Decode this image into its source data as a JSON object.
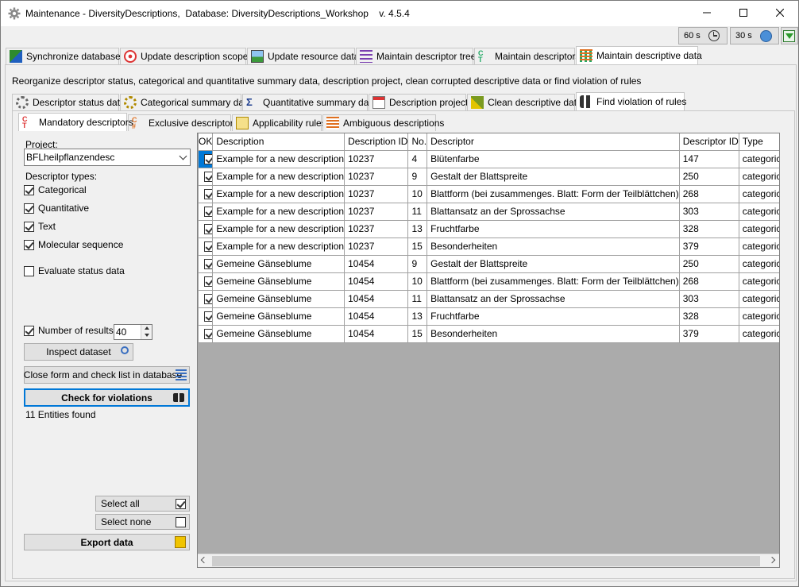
{
  "window": {
    "title": "Maintenance - DiversityDescriptions,  Database: DiversityDescriptions_Workshop    v. 4.5.4",
    "timer1": "60 s",
    "timer2": "30 s"
  },
  "main_tabs": [
    {
      "label": "Synchronize databases"
    },
    {
      "label": "Update description scopes"
    },
    {
      "label": "Update resource data"
    },
    {
      "label": "Maintain descriptor trees"
    },
    {
      "label": "Maintain descriptors"
    },
    {
      "label": "Maintain descriptive data"
    }
  ],
  "info_text": "Reorganize descriptor status, categorical and quantitative summary data, description project, clean corrupted descriptive data or find violation of rules",
  "sub_tabs": [
    {
      "label": "Descriptor status data"
    },
    {
      "label": "Categorical summary data"
    },
    {
      "label": "Quantitative summary data"
    },
    {
      "label": "Description project"
    },
    {
      "label": "Clean descriptive data"
    },
    {
      "label": "Find violation of rules"
    }
  ],
  "rule_tabs": [
    {
      "label": "Mandatory descriptors"
    },
    {
      "label": "Exclusive descriptors"
    },
    {
      "label": "Applicability rules"
    },
    {
      "label": "Ambiguous descriptions"
    }
  ],
  "left": {
    "project_label": "Project:",
    "project_value": "BFLheilpflanzendesc",
    "descriptor_types_label": "Descriptor types:",
    "types": [
      {
        "label": "Categorical",
        "checked": true
      },
      {
        "label": "Quantitative",
        "checked": true
      },
      {
        "label": "Text",
        "checked": true
      },
      {
        "label": "Molecular sequence",
        "checked": true
      }
    ],
    "evaluate_status": "Evaluate status data",
    "num_results_label": "Number of results:",
    "num_results_value": "40",
    "inspect_button": "Inspect dataset",
    "close_button": "Close form and check list in database",
    "check_button": "Check for violations",
    "status": "11 Entities found",
    "select_all": "Select all",
    "select_none": "Select none",
    "export": "Export data"
  },
  "grid": {
    "headers": [
      "OK",
      "Description",
      "Description ID",
      "No.",
      "Descriptor",
      "Descriptor ID",
      "Type"
    ],
    "rows": [
      [
        "Example for a new description",
        "10237",
        "4",
        "Blütenfarbe",
        "147",
        "categorica"
      ],
      [
        "Example for a new description",
        "10237",
        "9",
        "Gestalt der Blattspreite",
        "250",
        "categorica"
      ],
      [
        "Example for a new description",
        "10237",
        "10",
        "Blattform (bei zusammenges. Blatt: Form der Teilblättchen)",
        "268",
        "categorica"
      ],
      [
        "Example for a new description",
        "10237",
        "11",
        "Blattansatz an der Sprossachse",
        "303",
        "categorica"
      ],
      [
        "Example for a new description",
        "10237",
        "13",
        "Fruchtfarbe",
        "328",
        "categorica"
      ],
      [
        "Example for a new description",
        "10237",
        "15",
        "Besonderheiten",
        "379",
        "categorica"
      ],
      [
        "Gemeine Gänseblume",
        "10454",
        "9",
        "Gestalt der Blattspreite",
        "250",
        "categorica"
      ],
      [
        "Gemeine Gänseblume",
        "10454",
        "10",
        "Blattform (bei zusammenges. Blatt: Form der Teilblättchen)",
        "268",
        "categorica"
      ],
      [
        "Gemeine Gänseblume",
        "10454",
        "11",
        "Blattansatz an der Sprossachse",
        "303",
        "categorica"
      ],
      [
        "Gemeine Gänseblume",
        "10454",
        "13",
        "Fruchtfarbe",
        "328",
        "categorica"
      ],
      [
        "Gemeine Gänseblume",
        "10454",
        "15",
        "Besonderheiten",
        "379",
        "categorica"
      ]
    ]
  }
}
